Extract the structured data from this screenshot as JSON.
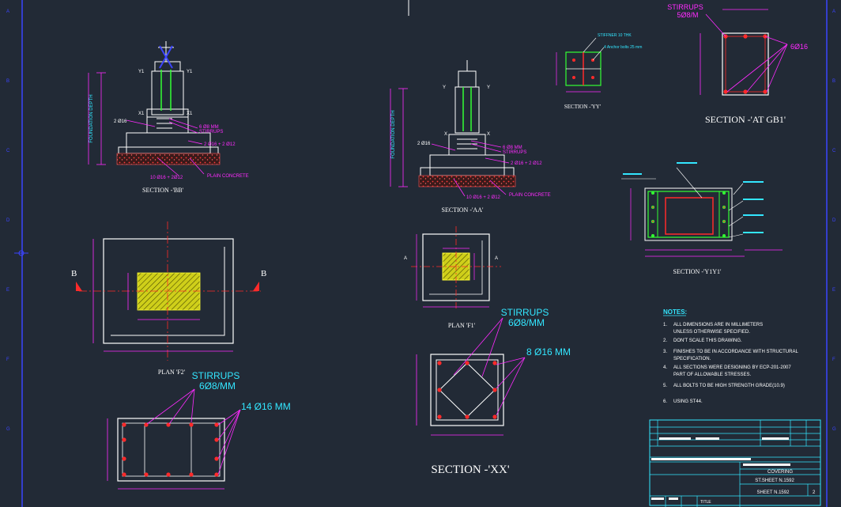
{
  "colors": {
    "background": "#222a36",
    "line": "#ffffff",
    "dim": "#ff2bff",
    "hatch": "#ffff33",
    "rebar": "#ff2a2a",
    "text_cyan": "#33e6ff",
    "steel": "#33ff33",
    "border": "#3b44ff"
  },
  "border_rows": [
    "A",
    "B",
    "C",
    "D",
    "E",
    "F",
    "G"
  ],
  "titles": {
    "section_bb": "SECTION -'BB'",
    "section_aa": "SECTION -'AA'",
    "section_yy": "SECTION -'YY'",
    "section_gb1": "SECTION -'AT GB1'",
    "section_y1y1": "SECTION -'Y1Y1'",
    "plan_f2": "PLAN 'F2'",
    "plan_f1": "PLAN 'F1'",
    "section_xx": "SECTION -'XX'"
  },
  "bb": {
    "depth_label": "FOUNDATION DEPTH",
    "bar_left": "2 Ø16",
    "stirrups_bars": "6 Ø8 MM",
    "stirrups": "STIRRUPS",
    "bars_top": "2 Ø16 + 2 Ø12",
    "plain": "PLAIN CONCRETE",
    "bars_bottom": "10 Ø16 + 2Ø12",
    "x1a": "X1",
    "x1b": "X1",
    "y1a": "Y1",
    "y1b": "Y1"
  },
  "aa": {
    "depth_label": "FOUNDATION DEPTH",
    "bar_left": "2 Ø16",
    "stirrups_bars": "6 Ø8 MM",
    "stirrups": "STIRRUPS",
    "bars_top": "2 Ø16 + 2 Ø12",
    "plain": "PLAIN CONCRETE",
    "bars_bottom": "10 Ø16 + 2 Ø12",
    "ya": "Y",
    "yb": "Y",
    "xa": "X",
    "xb": "X"
  },
  "yy": {
    "stiffner": "STIFFNER 10 THK",
    "anchor": "4 Anchor bolts 25 mm"
  },
  "gb1": {
    "stirrups": "STIRRUPS",
    "stirrups_spec": "5Ø8/M",
    "bars": "6Ø16"
  },
  "f2": {
    "marker_left": "B",
    "marker_right": "B"
  },
  "f1": {
    "marker_left": "A",
    "marker_right": "A"
  },
  "xx": {
    "stirrups": "STIRRUPS",
    "stirrups_spec": "6Ø8/MM",
    "bars": "8 Ø16 MM"
  },
  "gb_bottom": {
    "stirrups": "STIRRUPS",
    "stirrups_spec": "6Ø8/MM",
    "bars": "14 Ø16 MM"
  },
  "notes": {
    "title": "NOTES:",
    "items": [
      {
        "num": "1.",
        "text": "ALL DIMENSIONS ARE IN MILLIMETERS",
        "text2": "UNLESS OTHERWISE SPECIFIED."
      },
      {
        "num": "2.",
        "text": "DON'T SCALE THIS DRAWING.",
        "text2": ""
      },
      {
        "num": "3.",
        "text": "FINISHES TO BE IN ACCORDANCE WITH STRUCTURAL",
        "text2": "SPECIFICATION."
      },
      {
        "num": "4.",
        "text": "ALL SECTIONS WERE DESIGNING BY ECP-201-2007",
        "text2": "PART OF ALLOWABLE STRESSES."
      },
      {
        "num": "5.",
        "text": "ALL BOLTS TO BE HIGH STRENGTH GRADE(10.9)",
        "text2": ""
      },
      {
        "num": "6.",
        "text": "USING ST44.",
        "text2": ""
      }
    ]
  },
  "title_block": {
    "project": "COVERING",
    "sheet_ref": "ST.SHEET N.1592",
    "sheet_no": "SHEET N.1592",
    "page": "2",
    "title_label": "TITLE"
  }
}
